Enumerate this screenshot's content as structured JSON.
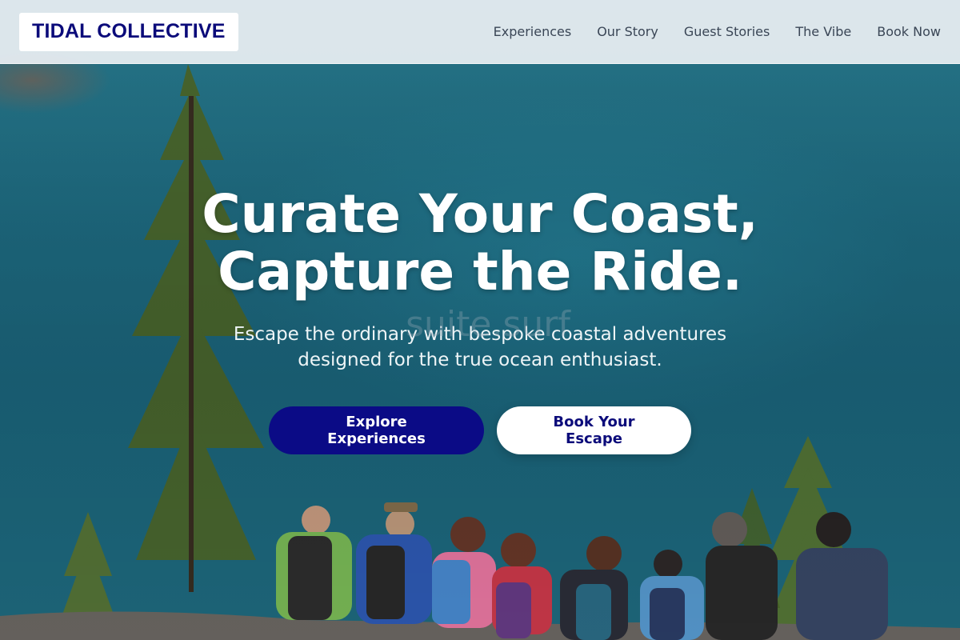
{
  "brand": {
    "logo_text": "TIDAL COLLECTIVE"
  },
  "nav": {
    "items": [
      {
        "label": "Experiences"
      },
      {
        "label": "Our Story"
      },
      {
        "label": "Guest Stories"
      },
      {
        "label": "The Vibe"
      },
      {
        "label": "Book Now"
      }
    ]
  },
  "hero": {
    "title_line1": "Curate Your Coast,",
    "title_line2": "Capture the Ride.",
    "ghost_text": "suite.surf",
    "subtitle_line1": "Escape the ordinary with bespoke coastal adventures",
    "subtitle_line2": "designed for the true ocean enthusiast.",
    "primary_cta": "Explore Experiences",
    "secondary_cta": "Book Your Escape"
  },
  "colors": {
    "brand_navy": "#0b0b86",
    "header_bg": "#ecf0f4",
    "water": "#1f6f86"
  }
}
